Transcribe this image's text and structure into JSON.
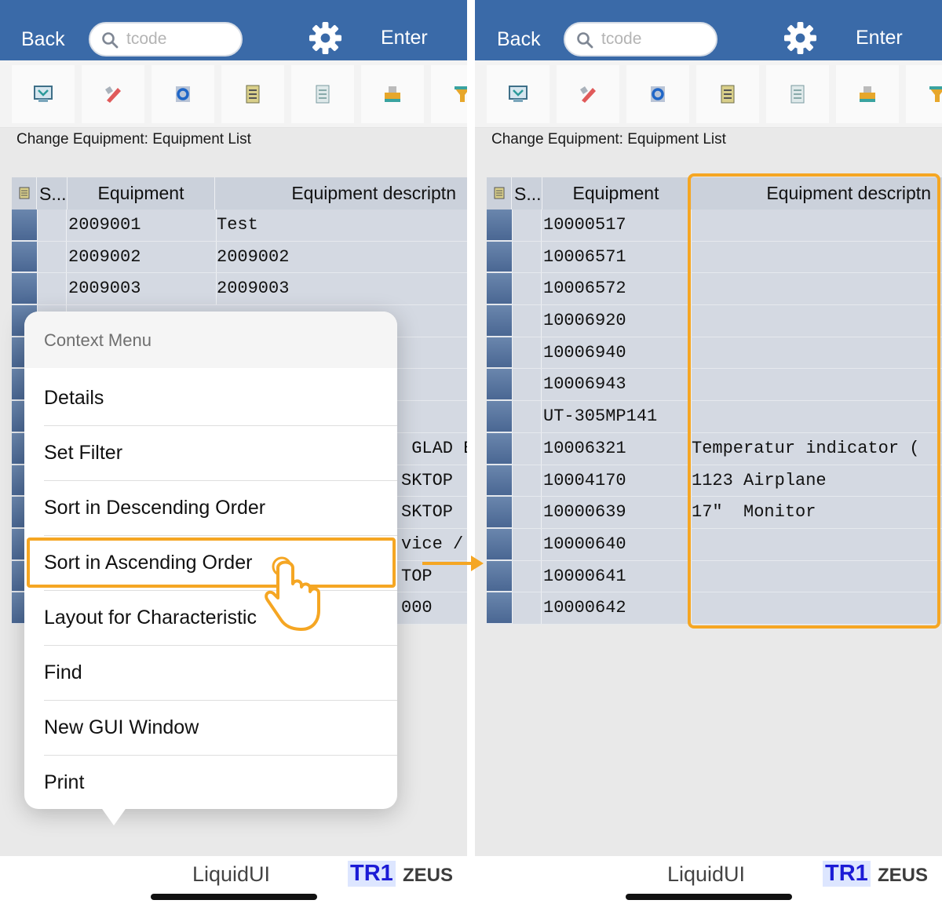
{
  "header": {
    "back_label": "Back",
    "search_placeholder": "tcode",
    "enter_label": "Enter"
  },
  "screen_title": "Change Equipment: Equipment List",
  "grid": {
    "columns": [
      "S...",
      "Equipment",
      "Equipment descriptn"
    ]
  },
  "left_rows": [
    {
      "equipment": "2009001",
      "description": "Test",
      "tail": ""
    },
    {
      "equipment": "2009002",
      "description": "2009002",
      "tail": ""
    },
    {
      "equipment": "2009003",
      "description": "2009003",
      "tail": ""
    },
    {
      "equipment": "",
      "description": "",
      "tail": ""
    },
    {
      "equipment": "",
      "description": "",
      "tail": ""
    },
    {
      "equipment": "",
      "description": "",
      "tail": ""
    },
    {
      "equipment": "",
      "description": "",
      "tail": ""
    },
    {
      "equipment": "",
      "description": "",
      "tail": " GLAD E"
    },
    {
      "equipment": "",
      "description": "",
      "tail": "SKTOP"
    },
    {
      "equipment": "",
      "description": "",
      "tail": "SKTOP"
    },
    {
      "equipment": "",
      "description": "",
      "tail": "vice /"
    },
    {
      "equipment": "",
      "description": "",
      "tail": "TOP"
    },
    {
      "equipment": "",
      "description": "",
      "tail": "000"
    }
  ],
  "right_rows": [
    {
      "equipment": "10000517",
      "description": ""
    },
    {
      "equipment": "10006571",
      "description": ""
    },
    {
      "equipment": "10006572",
      "description": ""
    },
    {
      "equipment": "10006920",
      "description": ""
    },
    {
      "equipment": "10006940",
      "description": ""
    },
    {
      "equipment": "10006943",
      "description": ""
    },
    {
      "equipment": "UT-305MP141",
      "description": ""
    },
    {
      "equipment": "10006321",
      "description": "Temperatur indicator ("
    },
    {
      "equipment": "10004170",
      "description": "1123 Airplane"
    },
    {
      "equipment": "10000639",
      "description": "17\"  Monitor"
    },
    {
      "equipment": "10000640",
      "description": ""
    },
    {
      "equipment": "10000641",
      "description": ""
    },
    {
      "equipment": "10000642",
      "description": ""
    }
  ],
  "context_menu": {
    "title": "Context Menu",
    "items": [
      "Details",
      "Set Filter",
      "Sort in Descending Order",
      "Sort in Ascending Order",
      "Layout for Characteristic",
      "Find",
      "New GUI Window",
      "Print"
    ]
  },
  "footer": {
    "brand": "LiquidUI",
    "system": "TR1",
    "host": "ZEUS"
  },
  "colors": {
    "header_blue": "#3a6aa8",
    "highlight_orange": "#f5a623",
    "grid_row": "#d4d9e2"
  },
  "toolbar_icons": [
    "display-icon",
    "edit-icon",
    "refresh-icon",
    "list-icon",
    "document-icon",
    "print-icon",
    "filter-icon"
  ]
}
